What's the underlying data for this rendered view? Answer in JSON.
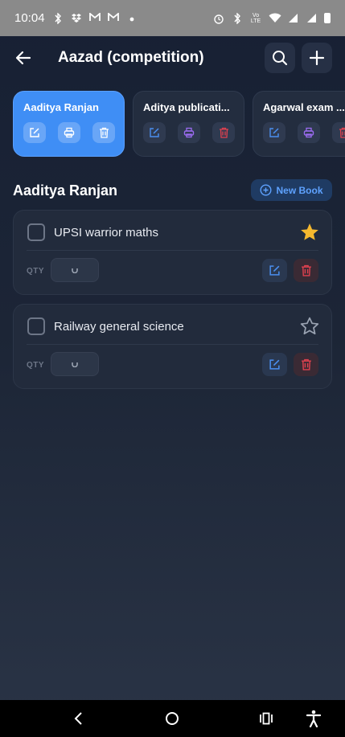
{
  "status_bar": {
    "time": "10:04",
    "left_icons": [
      "bluetooth-icon",
      "dropbox-icon",
      "gmail-icon",
      "gmail-icon",
      "dot-icon"
    ],
    "right_icons": [
      "alarm-icon",
      "bluetooth-icon",
      "volte-icon",
      "wifi-icon",
      "signal-icon",
      "signal-icon",
      "battery-icon"
    ],
    "volte_label": "Vo LTE"
  },
  "header": {
    "title": "Aazad (competition)",
    "back_icon": "arrow-left-icon",
    "search_icon": "search-icon",
    "add_icon": "plus-icon"
  },
  "publishers": [
    {
      "name": "Aaditya Ranjan",
      "active": true
    },
    {
      "name": "Aditya publicati...",
      "active": false
    },
    {
      "name": "Agarwal exam ...",
      "active": false
    }
  ],
  "section": {
    "title": "Aaditya Ranjan",
    "new_book_label": "New Book"
  },
  "books": [
    {
      "title": "UPSI warrior maths",
      "starred": true,
      "qty_label": "QTY",
      "qty_value": ""
    },
    {
      "title": "Railway general science",
      "starred": false,
      "qty_label": "QTY",
      "qty_value": ""
    }
  ],
  "colors": {
    "accent": "#3f8ef5",
    "star": "#f5b82e",
    "edit": "#4a8ff0",
    "delete": "#e0414f",
    "print": "#9b6cf0"
  },
  "nav_bar": [
    "back-icon",
    "home-icon",
    "recents-icon",
    "accessibility-icon"
  ]
}
